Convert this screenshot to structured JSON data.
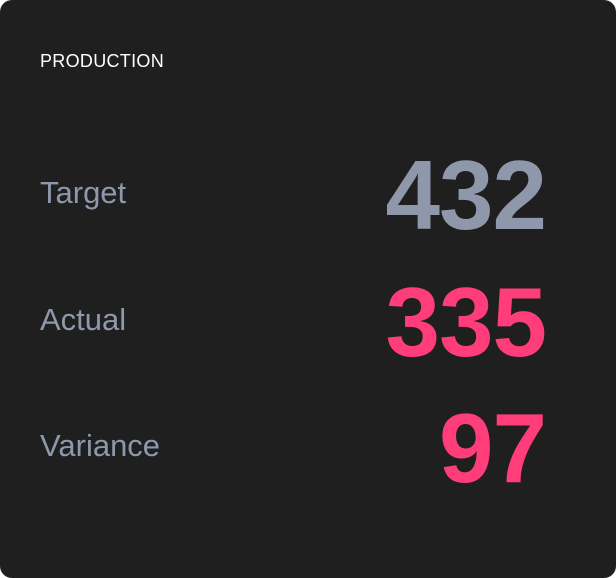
{
  "card": {
    "title": "PRODUCTION",
    "metrics": [
      {
        "label": "Target",
        "value": "432",
        "color": "#8e98aa"
      },
      {
        "label": "Actual",
        "value": "335",
        "color": "#ff3d7a"
      },
      {
        "label": "Variance",
        "value": "97",
        "color": "#ff3d7a"
      }
    ]
  },
  "colors": {
    "background": "#1f1f20",
    "title": "#ffffff",
    "label": "#8e98aa",
    "neutral_value": "#8e98aa",
    "alert_value": "#ff3d7a"
  }
}
